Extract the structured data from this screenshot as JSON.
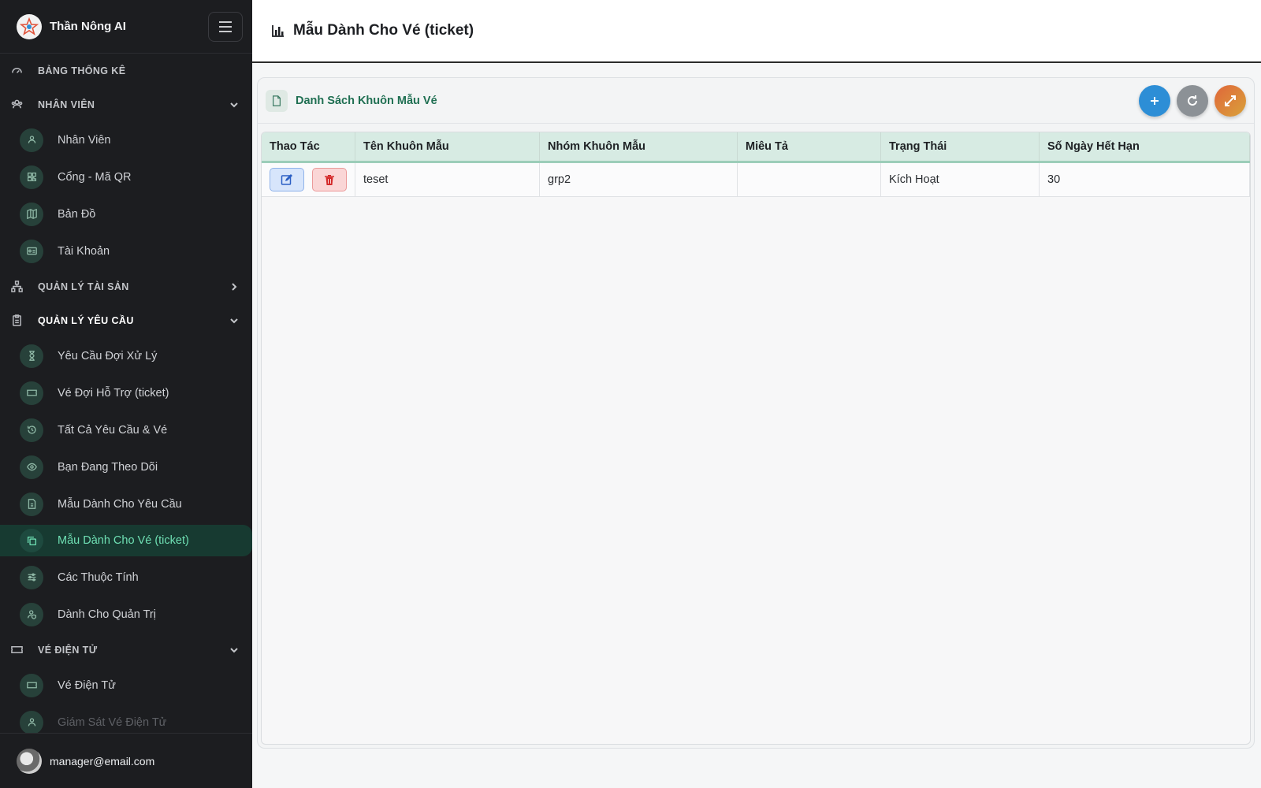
{
  "app": {
    "title": "Thần Nông AI"
  },
  "page": {
    "title": "Mẫu Dành Cho Vé (ticket)"
  },
  "sidebar": {
    "sections": {
      "dashboard": {
        "label": "BẢNG THỐNG KÊ"
      },
      "staff": {
        "label": "NHÂN VIÊN"
      },
      "assets": {
        "label": "QUẢN LÝ TÀI SẢN"
      },
      "requests": {
        "label": "QUẢN LÝ YÊU CẦU"
      },
      "eticket": {
        "label": "VÉ ĐIỆN TỬ"
      }
    },
    "staff_items": [
      {
        "label": "Nhân Viên"
      },
      {
        "label": "Cổng - Mã QR"
      },
      {
        "label": "Bản Đồ"
      },
      {
        "label": "Tài Khoản"
      }
    ],
    "request_items": [
      {
        "label": "Yêu Cầu Đợi Xử Lý"
      },
      {
        "label": "Vé Đợi Hỗ Trợ (ticket)"
      },
      {
        "label": "Tất Cả Yêu Cầu & Vé"
      },
      {
        "label": "Bạn Đang Theo Dõi"
      },
      {
        "label": "Mẫu Dành Cho Yêu Cầu"
      },
      {
        "label": "Mẫu Dành Cho Vé (ticket)"
      },
      {
        "label": "Các Thuộc Tính"
      },
      {
        "label": "Dành Cho Quản Trị"
      }
    ],
    "eticket_items": [
      {
        "label": "Vé Điện Tử"
      },
      {
        "label": "Giám Sát Vé Điện Tử"
      }
    ],
    "user": {
      "email": "manager@email.com"
    }
  },
  "card": {
    "title": "Danh Sách Khuôn Mẫu Vé"
  },
  "table": {
    "headers": [
      "Thao Tác",
      "Tên Khuôn Mẫu",
      "Nhóm Khuôn Mẫu",
      "Miêu Tả",
      "Trạng Thái",
      "Số Ngày Hết Hạn"
    ],
    "rows": [
      {
        "name": "teset",
        "group": "grp2",
        "description": "",
        "status": "Kích Hoạt",
        "expiry_days": "30"
      }
    ]
  },
  "colors": {
    "accent": "#1f6f52",
    "add": "#2d8ed6",
    "sidebar_bg": "#1c1d20",
    "active_item": "#6fe0b4"
  }
}
